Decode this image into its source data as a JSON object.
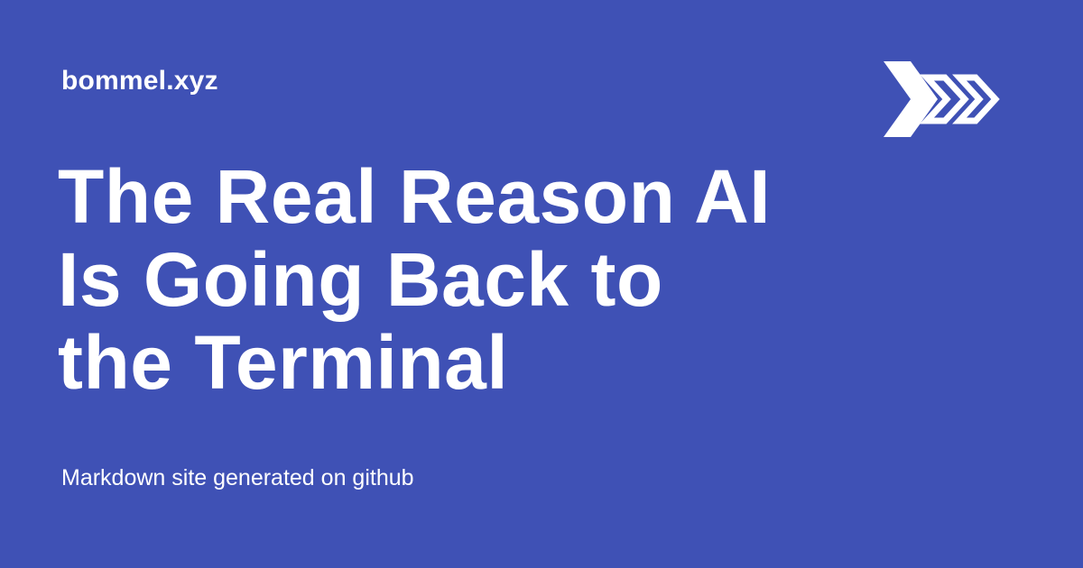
{
  "site": {
    "name": "bommel.xyz"
  },
  "post": {
    "title_lines": [
      "The Real Reason AI",
      "Is Going Back to",
      "the Terminal"
    ]
  },
  "footer": {
    "text": "Markdown site generated on github"
  },
  "logo": {
    "icon": "triple-chevron-right-icon"
  },
  "colors": {
    "background": "#3f51b5",
    "foreground": "#ffffff"
  }
}
